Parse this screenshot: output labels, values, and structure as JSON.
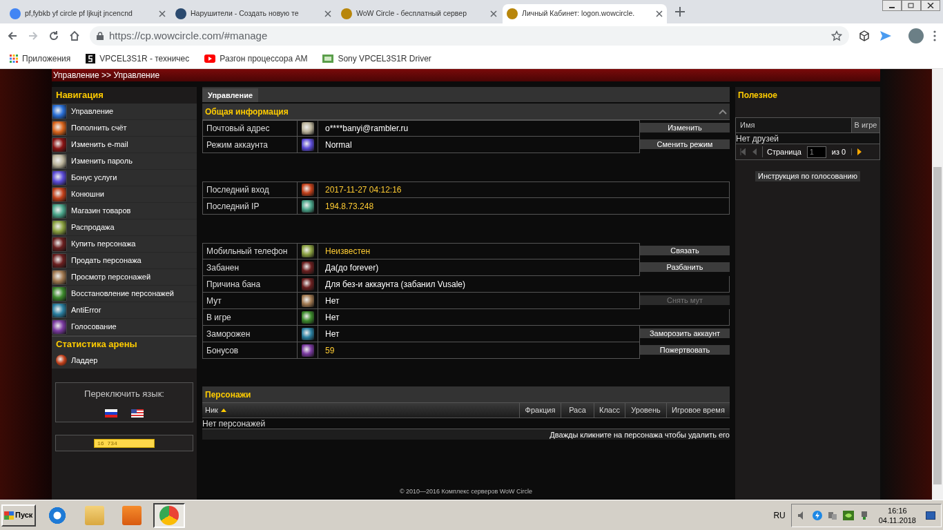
{
  "browser": {
    "tabs": [
      {
        "title": "pf,fybkb yf circle pf ljkujt jncencnd",
        "selected": false,
        "kind": "google"
      },
      {
        "title": "Нарушители - Создать новую те",
        "selected": false,
        "kind": "forum"
      },
      {
        "title": "WoW Circle - бесплатный сервер",
        "selected": false,
        "kind": "wow"
      },
      {
        "title": "Личный Кабинет: logon.wowcircle.",
        "selected": true,
        "kind": "wow"
      }
    ],
    "address": "https://cp.wowcircle.com/#manage",
    "bookmarks": [
      {
        "label": "Приложения",
        "kind": "apps"
      },
      {
        "label": "VPCEL3S1R - техничес",
        "kind": "s"
      },
      {
        "label": "Разгон процессора AM",
        "kind": "youtube"
      },
      {
        "label": "Sony VPCEL3S1R Driver",
        "kind": "driver"
      }
    ]
  },
  "breadcrumb": "Управление >> Управление",
  "navigation": {
    "title": "Навигация",
    "items": [
      "Управление",
      "Пополнить счёт",
      "Изменить e-mail",
      "Изменить пароль",
      "Бонус услуги",
      "Конюшни",
      "Магазин товаров",
      "Распродажа",
      "Купить персонажа",
      "Продать персонажа",
      "Просмотр персонажей",
      "Восстановление персонажей",
      "AntiError",
      "Голосование"
    ]
  },
  "arena": {
    "title": "Статистика арены",
    "items": [
      "Ладдер"
    ]
  },
  "language": {
    "title": "Переключить язык:",
    "flags": [
      {
        "kind": "ru"
      },
      {
        "kind": "us"
      }
    ]
  },
  "counter": "16 734",
  "main": {
    "tab": "Управление",
    "section": "Общая информация",
    "groups": [
      [
        {
          "label": "Почтовый адрес",
          "value": "o****banyi@rambler.ru",
          "highlighted": false,
          "button": {
            "label": "Изменить",
            "disabled": false
          }
        },
        {
          "label": "Режим аккаунта",
          "value": "Normal",
          "highlighted": false,
          "button": {
            "label": "Сменить режим",
            "disabled": false
          }
        }
      ],
      [
        {
          "label": "Последний вход",
          "value": "2017-11-27 04:12:16",
          "highlighted": true
        },
        {
          "label": "Последний IP",
          "value": "194.8.73.248",
          "highlighted": true
        }
      ],
      [
        {
          "label": "Мобильный телефон",
          "value": "Неизвестен",
          "highlighted": true,
          "button": {
            "label": "Связать",
            "disabled": false
          }
        },
        {
          "label": "Забанен",
          "value": "Да(до forever)",
          "highlighted": false,
          "button": {
            "label": "Разбанить",
            "disabled": false
          }
        },
        {
          "label": "Причина бана",
          "value": "Для без-и аккаунта (забанил Vusale)",
          "highlighted": false
        },
        {
          "label": "Мут",
          "value": "Нет",
          "highlighted": false,
          "button": {
            "label": "Снять мут",
            "disabled": true
          }
        },
        {
          "label": "В игре",
          "value": "Нет",
          "highlighted": false
        },
        {
          "label": "Заморожен",
          "value": "Нет",
          "highlighted": false,
          "button": {
            "label": "Заморозить аккаунт",
            "disabled": false
          }
        },
        {
          "label": "Бонусов",
          "value": "59",
          "highlighted": true,
          "button": {
            "label": "Пожертвовать",
            "disabled": false
          }
        }
      ]
    ]
  },
  "characters": {
    "title": "Персонажи",
    "columns": [
      {
        "label": "Ник",
        "sorted": true
      },
      {
        "label": "Фракция",
        "sorted": false
      },
      {
        "label": "Раса",
        "sorted": false
      },
      {
        "label": "Класс",
        "sorted": false
      },
      {
        "label": "Уровень",
        "sorted": false
      },
      {
        "label": "Игровое время",
        "sorted": false
      }
    ],
    "empty": "Нет персонажей",
    "hint": "Дважды кликните на персонажа чтобы удалить его"
  },
  "footer": "© 2010—2016 Комплекс серверов WoW Circle",
  "useful": {
    "title": "Полезное",
    "columns": [
      "Имя",
      "В игре"
    ],
    "empty": "Нет друзей",
    "page_label": "Страница",
    "page": "1",
    "of": "из 0",
    "vote_button": "Инструкция по голосованию"
  },
  "taskbar": {
    "start": "Пуск",
    "apps": [
      {
        "kind": "ie",
        "selected": false
      },
      {
        "kind": "explorer",
        "selected": false
      },
      {
        "kind": "media",
        "selected": false
      },
      {
        "kind": "chrome",
        "selected": true
      }
    ],
    "lang": "RU",
    "time": "16:16",
    "date": "04.11.2018"
  }
}
